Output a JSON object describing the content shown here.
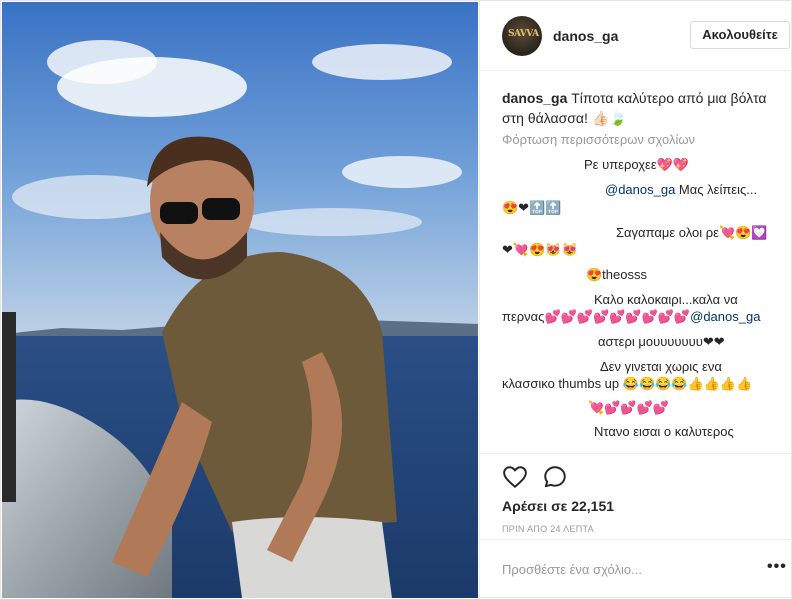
{
  "header": {
    "avatar_text": "SAVVA",
    "username": "danos_ga",
    "follow_label": "Ακολουθείτε"
  },
  "caption": {
    "username": "danos_ga",
    "text": " Τίποτα καλύτερο από μια βόλτα στη θάλασσα! 👍🏻🍃"
  },
  "load_more": "Φόρτωση περισσότερων σχολίων",
  "comments": [
    {
      "text": "Ρε υπεροχεε💖💖"
    },
    {
      "mention": "@danos_ga",
      "text": " Μας λείπεις..."
    },
    {
      "text": "😍❤🔝🔝"
    },
    {
      "text": "Σαγαπαμε ολοι ρε💘😍💟"
    },
    {
      "text": "❤💘😍😻😻"
    },
    {
      "text": "😍theosss"
    },
    {
      "text": "Καλο καλοκαιρι...καλα να"
    },
    {
      "text": "περνας💕💕💕💕💕💕💕💕💕",
      "mention": "@danos_ga"
    },
    {
      "text": "αστερι μουυυυυυυ❤❤"
    },
    {
      "text": "Δεν γινεται χωρις ενα"
    },
    {
      "text": "κλασσικο thumbs up 😂😂😂😂👍👍👍👍"
    },
    {
      "text": "💘💕💕💕💕"
    },
    {
      "text": "Ντανο εισαι ο καλυτερος"
    }
  ],
  "actions": {
    "like_icon": "heart-icon",
    "comment_icon": "comment-icon"
  },
  "likes": "Αρέσει σε 22,151",
  "timestamp": "ΠΡΙΝ ΑΠΟ 24 ΛΕΠΤΑ",
  "add_comment": {
    "placeholder": "Προσθέστε ένα σχόλιο...",
    "more_label": "•••"
  },
  "colors": {
    "mention": "#003569",
    "muted": "#999999",
    "border": "#efefef"
  }
}
